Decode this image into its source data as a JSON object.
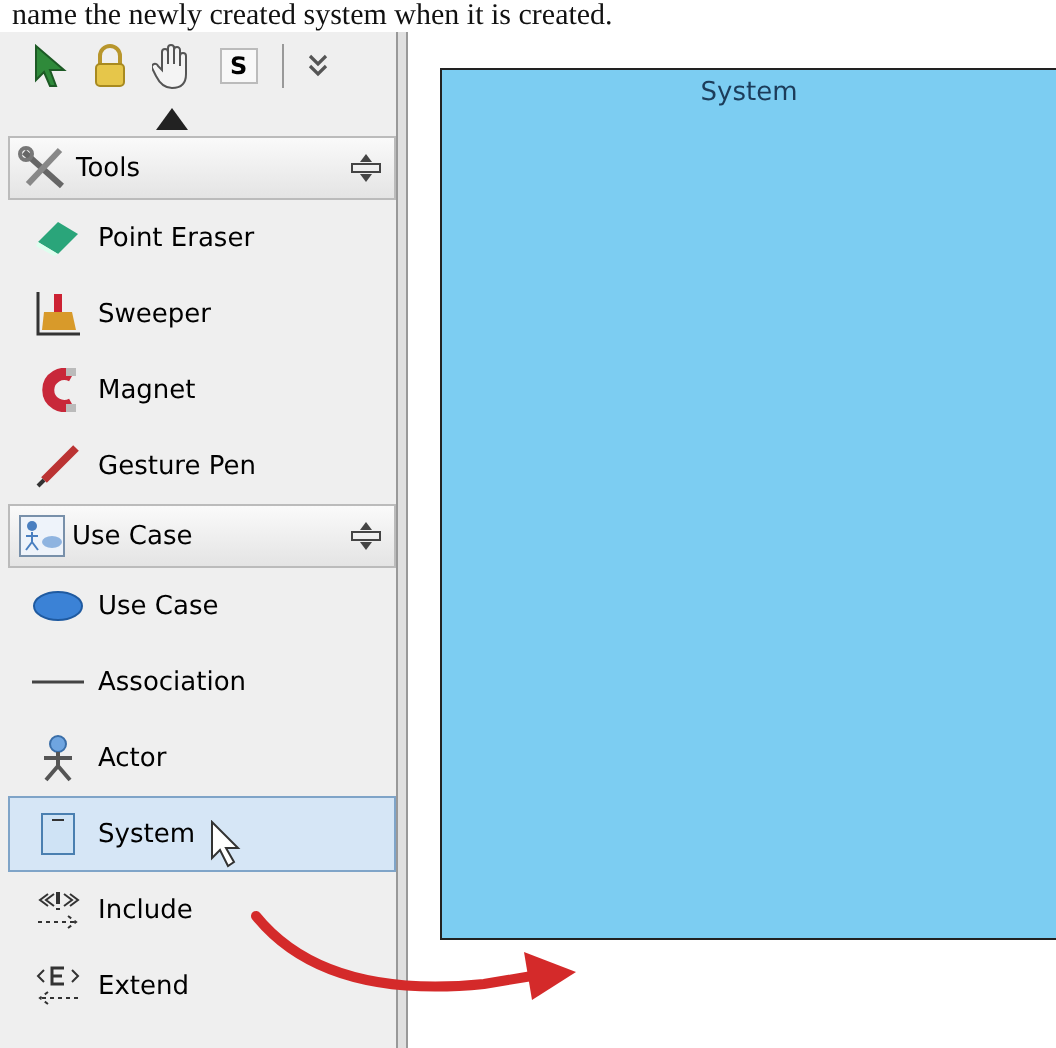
{
  "intro_text": "name the newly created system when it is created.",
  "toolbar": {
    "stamp_label": "S"
  },
  "palette": {
    "groups": [
      {
        "title": "Tools",
        "kind": "tools",
        "items": [
          {
            "label": "Point Eraser",
            "kind": "eraser",
            "selected": false
          },
          {
            "label": "Sweeper",
            "kind": "sweeper",
            "selected": false
          },
          {
            "label": "Magnet",
            "kind": "magnet",
            "selected": false
          },
          {
            "label": "Gesture Pen",
            "kind": "pen",
            "selected": false
          }
        ]
      },
      {
        "title": "Use Case",
        "kind": "usecase",
        "items": [
          {
            "label": "Use Case",
            "kind": "ellipse",
            "selected": false
          },
          {
            "label": "Association",
            "kind": "line",
            "selected": false
          },
          {
            "label": "Actor",
            "kind": "actor",
            "selected": false
          },
          {
            "label": "System",
            "kind": "system",
            "selected": true
          },
          {
            "label": "Include",
            "kind": "include",
            "selected": false
          },
          {
            "label": "Extend",
            "kind": "extend",
            "selected": false
          }
        ]
      }
    ]
  },
  "canvas": {
    "system_label": "System"
  }
}
